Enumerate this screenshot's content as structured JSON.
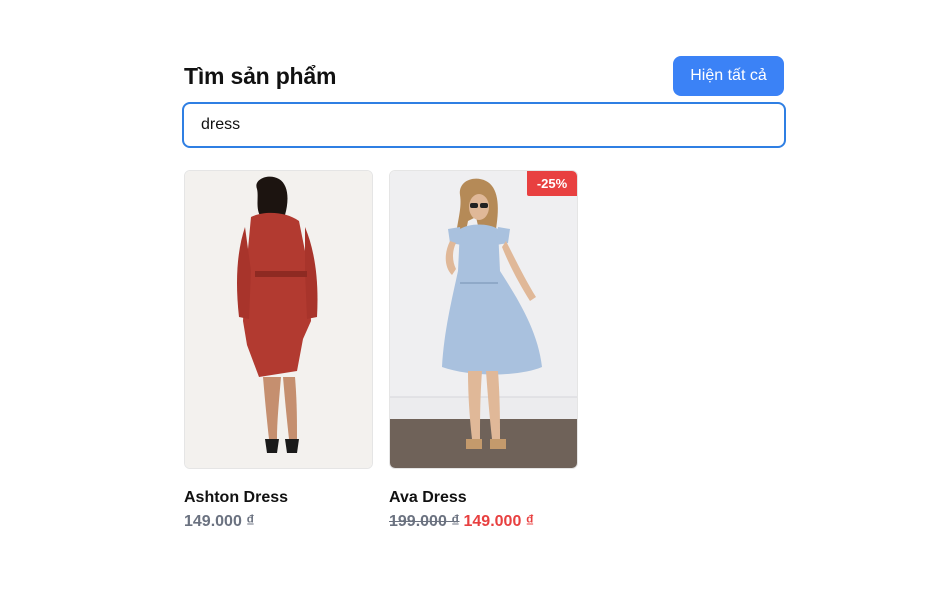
{
  "header": {
    "title": "Tìm sản phẩm",
    "show_all_label": "Hiện tất cả"
  },
  "search": {
    "value": "dress",
    "placeholder": ""
  },
  "products": [
    {
      "name": "Ashton Dress",
      "price": "149.000 ₫",
      "image": "red-dress-photo"
    },
    {
      "name": "Ava Dress",
      "badge": "-25%",
      "old_price": "199.000 ₫",
      "sale_price": "149.000 ₫",
      "image": "blue-dress-photo"
    }
  ],
  "colors": {
    "accent": "#3b82f6",
    "search_border": "#2f7fe3",
    "sale": "#e84040",
    "muted": "#6b7280"
  }
}
